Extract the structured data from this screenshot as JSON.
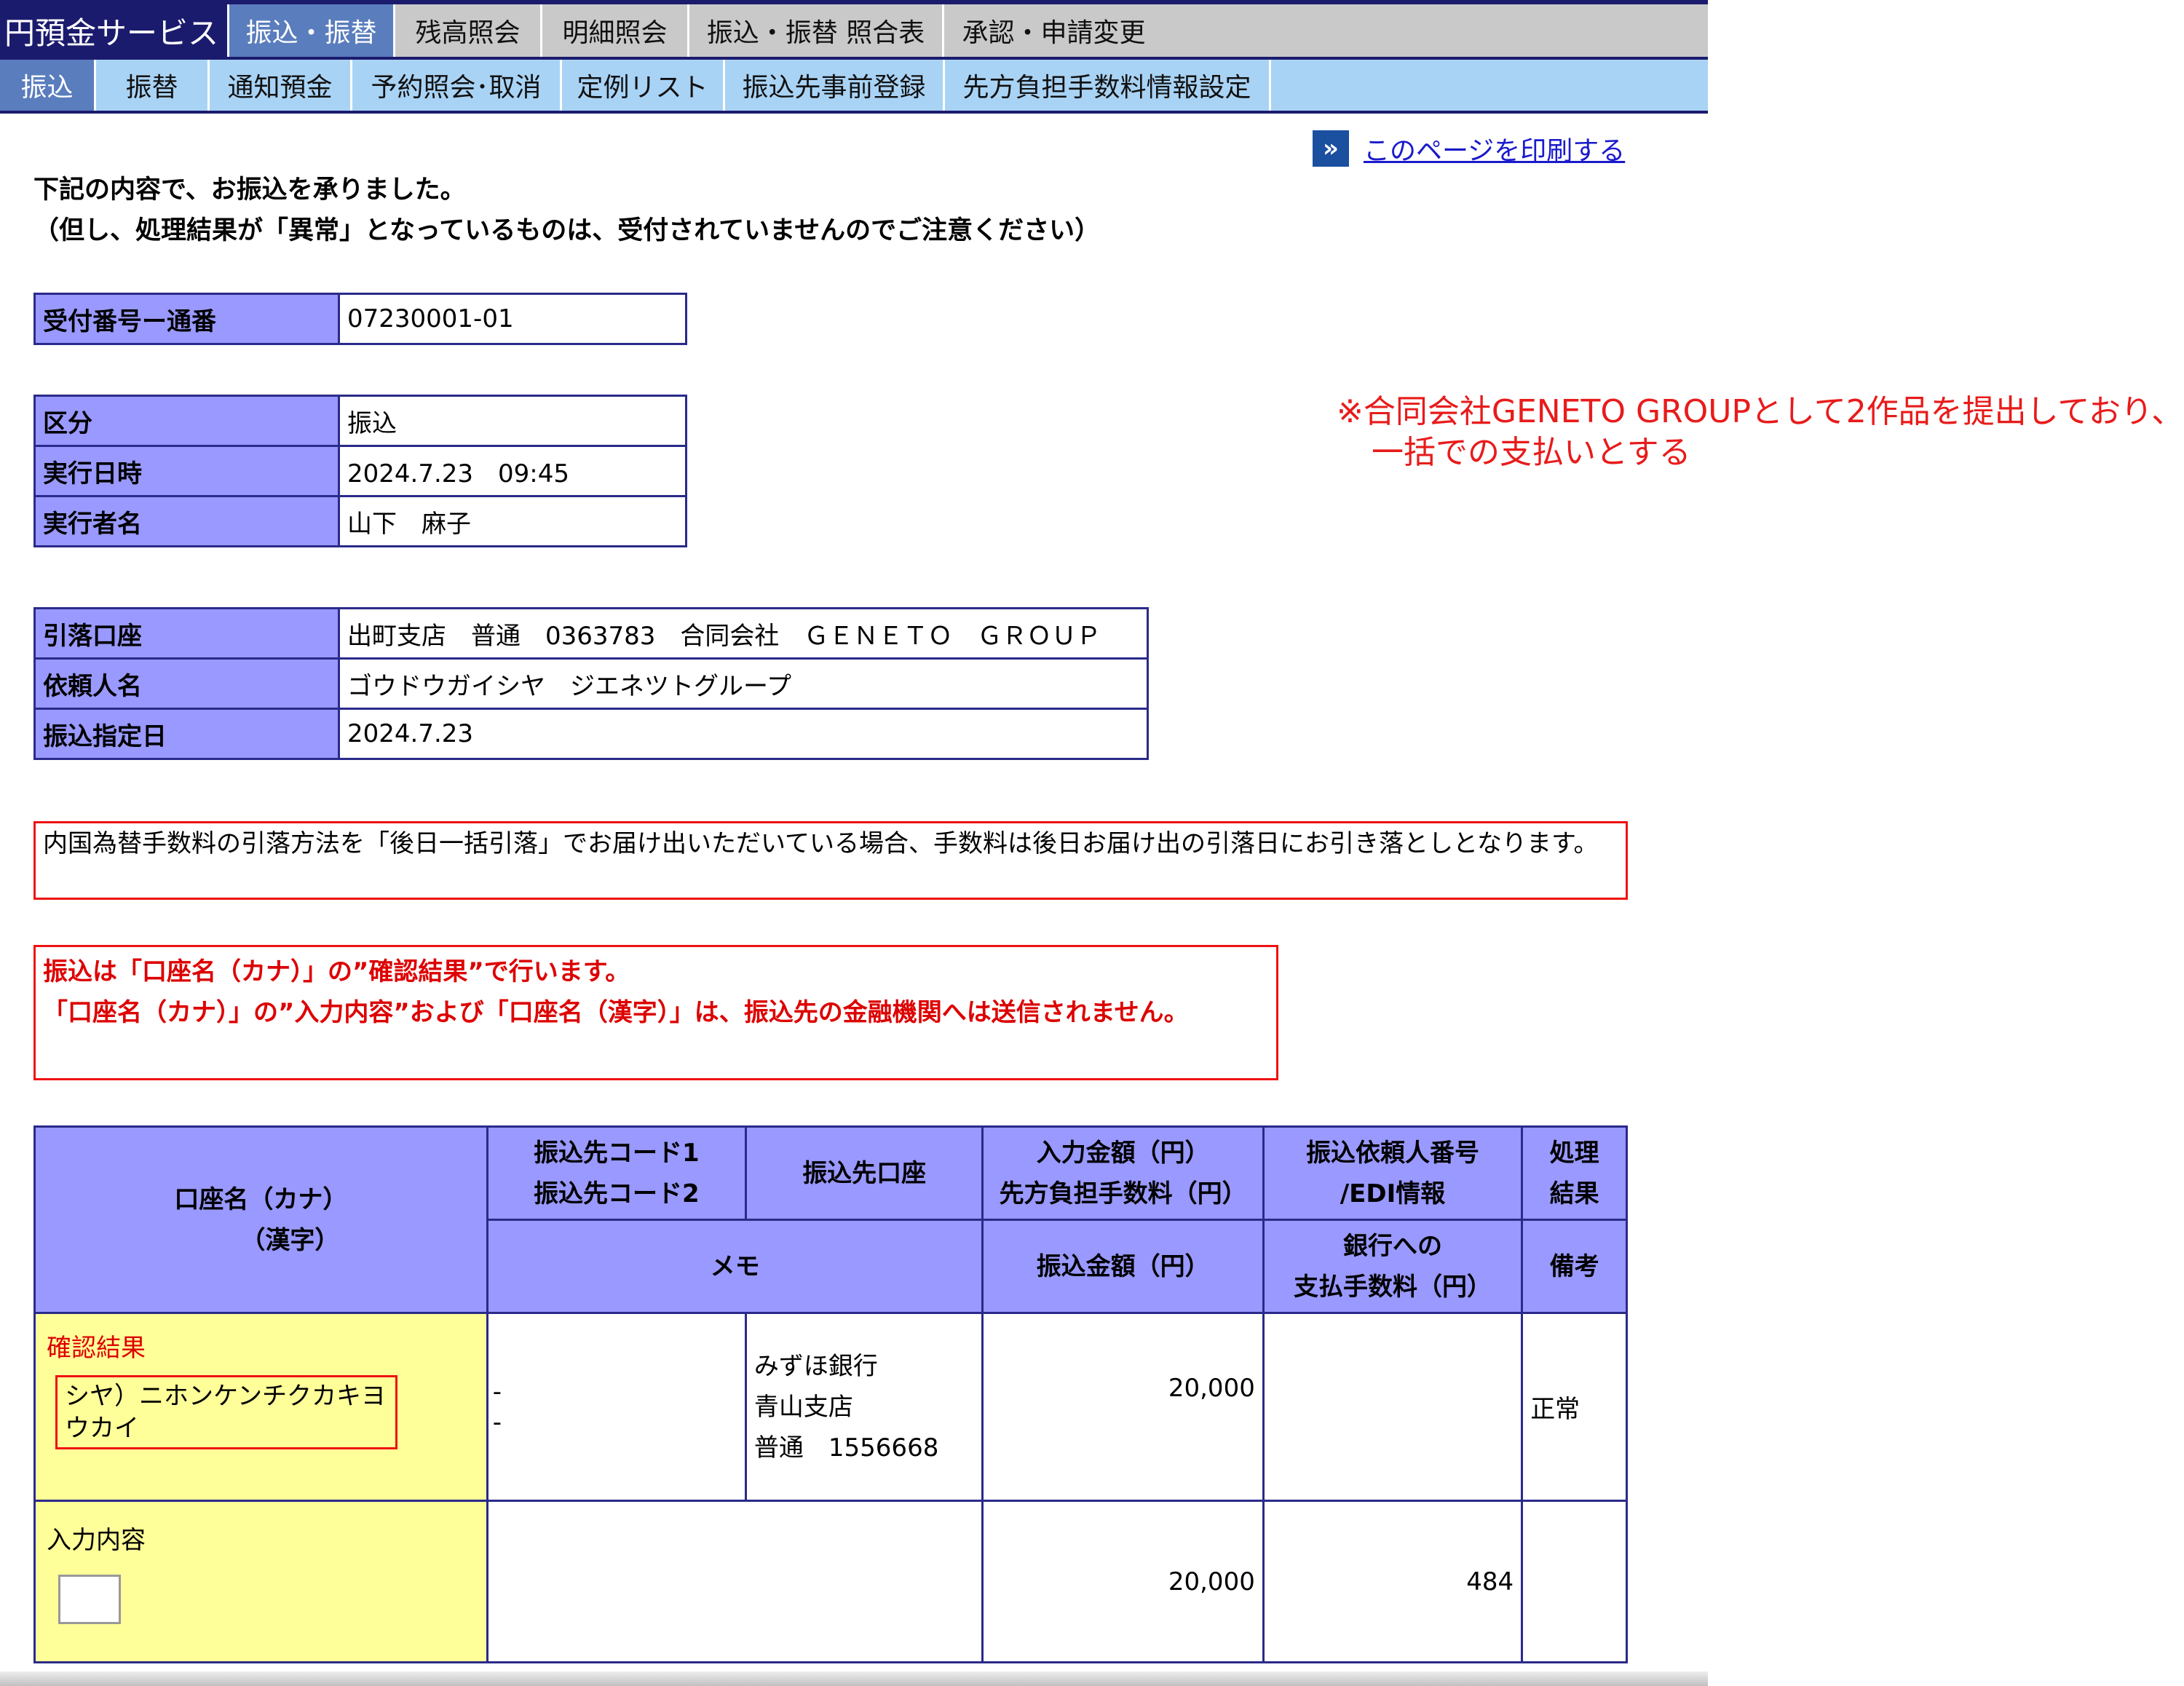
{
  "topnav": {
    "brand": "円預金サービス",
    "tabs": [
      {
        "label": "振込・振替",
        "active": true
      },
      {
        "label": "残高照会",
        "active": false
      },
      {
        "label": "明細照会",
        "active": false
      },
      {
        "label": "振込・振替 照合表",
        "active": false
      },
      {
        "label": "承認・申請変更",
        "active": false
      }
    ]
  },
  "subnav": {
    "tabs": [
      {
        "label": "振込",
        "active": true
      },
      {
        "label": "振替",
        "active": false
      },
      {
        "label": "通知預金",
        "active": false
      },
      {
        "label": "予約照会･取消",
        "active": false
      },
      {
        "label": "定例リスト",
        "active": false
      },
      {
        "label": "振込先事前登録",
        "active": false
      },
      {
        "label": "先方負担手数料情報設定",
        "active": false
      }
    ]
  },
  "print": {
    "icon": "double-chevron-right-icon",
    "label": "このページを印刷する"
  },
  "message": {
    "line1": "下記の内容で、お振込を承りました。",
    "line2": "（但し、処理結果が「異常」となっているものは、受付されていませんのでご注意ください）"
  },
  "receipt": {
    "label": "受付番号ー通番",
    "value": "07230001-01"
  },
  "execution": {
    "kubun_label": "区分",
    "kubun_value": "振込",
    "datetime_label": "実行日時",
    "datetime_value": "2024.7.23　09:45",
    "executor_label": "実行者名",
    "executor_value": "山下　麻子"
  },
  "account": {
    "debit_label": "引落口座",
    "debit_value": "出町支店　普通　0363783　合同会社　ＧＥＮＥＴＯ　ＧＲＯＵＰ",
    "requester_label": "依頼人名",
    "requester_value": "ゴウドウガイシヤ　ジエネツトグループ",
    "date_label": "振込指定日",
    "date_value": "2024.7.23"
  },
  "notice_fee": "内国為替手数料の引落方法を「後日一括引落」でお届け出いただいている場合、手数料は後日お届け出の引落日にお引き落としとなります。",
  "notice_red": {
    "line1": "振込は「口座名（カナ）」の”確認結果”で行います。",
    "line2": "「口座名（カナ）」の”入力内容”および「口座名（漢字）」は、振込先の金融機関へは送信されません。"
  },
  "annotation": {
    "line1": "※合同会社GENETO GROUPとして2作品を提出しており、",
    "line2": "一括での支払いとする"
  },
  "table": {
    "headers": {
      "name_kana": "口座名（カナ）",
      "name_kanji": "（漢字）",
      "code1": "振込先コード1",
      "code2": "振込先コード2",
      "dest_account": "振込先口座",
      "input_amount": "入力金額（円）",
      "payee_fee": "先方負担手数料（円）",
      "requester_no": "振込依頼人番号",
      "edi": "/EDI情報",
      "result1": "処理",
      "result2": "結果",
      "memo": "メモ",
      "transfer_amount": "振込金額（円）",
      "bank_fee1": "銀行への",
      "bank_fee2": "支払手数料（円）",
      "remarks": "備考"
    },
    "row": {
      "confirm_label": "確認結果",
      "kana_result": "シヤ）ニホンケンチクカキヨウカイ",
      "code1": "-",
      "code2": "-",
      "bank": "みずほ銀行",
      "branch": "青山支店",
      "account": "普通　1556668",
      "input_amount": "20,000",
      "result": "正常",
      "input_label": "入力内容",
      "transfer_amount": "20,000",
      "bank_fee": "484"
    }
  }
}
